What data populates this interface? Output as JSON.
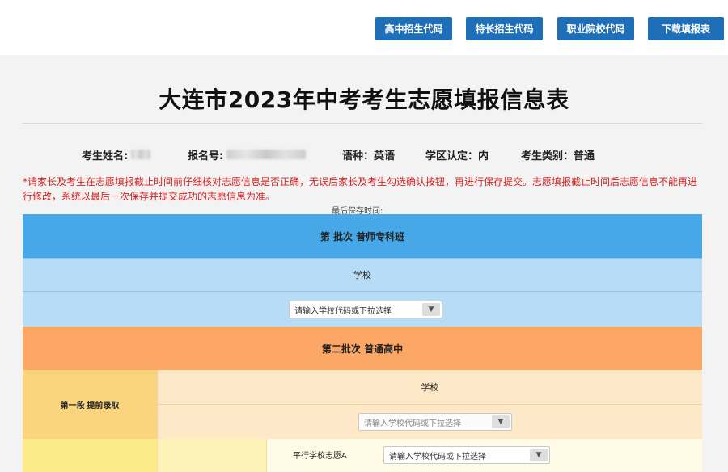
{
  "toolbar": {
    "btn_high_school_codes": "高中招生代码",
    "btn_specialty_codes": "特长招生代码",
    "btn_vocational_codes": "职业院校代码",
    "btn_download_form": "下载填报表"
  },
  "page_title": "大连市2023年中考考生志愿填报信息表",
  "student_info": {
    "name_label": "考生姓名:",
    "reg_no_label": "报名号:",
    "language": "语种：英语",
    "district": "学区认定：内",
    "category": "考生类别：普通"
  },
  "notice": "*请家长及考生在志愿填报截止时间前仔细核对志愿信息是否正确，无误后家长及考生勾选确认按钮，再进行保存提交。志愿填报截止时间后志愿信息不能再进行修改，系统以最后一次保存并提交成功的志愿信息为准。",
  "last_saved_label": "最后保存时间:",
  "batch1": {
    "title": "第  批次  普师专科班",
    "school_header": "学校",
    "select_placeholder": "请输入学校代码或下拉选择"
  },
  "batch2": {
    "title": "第二批次  普通高中",
    "stage1_label": "第一段  提前录取",
    "school_header": "学校",
    "select_placeholder": "请输入学校代码或下拉选择",
    "parallel_a_label": "平行学校志愿A",
    "parallel_a_placeholder": "请输入学校代码或下拉选择"
  },
  "colors": {
    "button_blue": "#1f6fb8",
    "batch1_header": "#46a8e6",
    "batch1_body": "#b7dcf5",
    "batch2_header": "#fca765",
    "stage1_left": "#fbd57e",
    "stage1_body": "#fde9c7",
    "notice_red": "#d62222"
  }
}
